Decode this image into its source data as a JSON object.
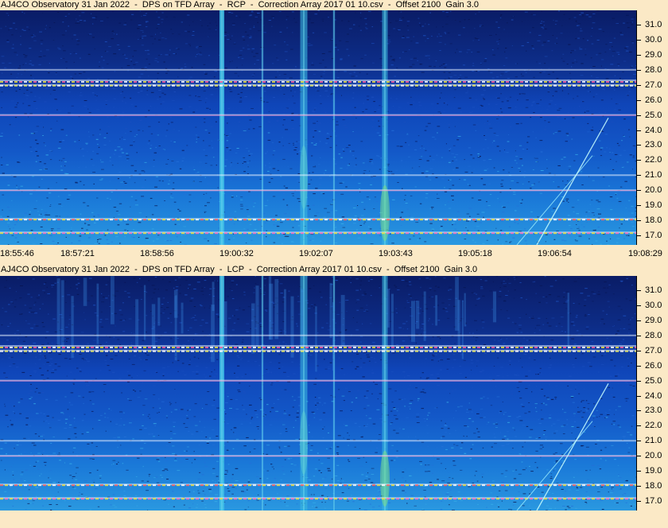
{
  "panels": [
    {
      "title": "AJ4CO Observatory 31 Jan 2022  -  DPS on TFD Array  -  RCP  -  Correction Array 2017 01 10.csv  -  Offset 2100  Gain 3.0",
      "polarization": "RCP"
    },
    {
      "title": "AJ4CO Observatory 31 Jan 2022  -  DPS on TFD Array  -  LCP  -  Correction Array 2017 01 10.csv  -  Offset 2100  Gain 3.0",
      "polarization": "LCP"
    }
  ],
  "chart_data": {
    "type": "heatmap",
    "description_colors": {
      "low": "#0a1a5a",
      "mid": "#1060d0",
      "high": "#40c8e0",
      "hot": "#f0f060",
      "background": "#fbe9c6"
    },
    "y_ticks": [
      "31.0",
      "30.0",
      "29.0",
      "28.0",
      "27.0",
      "26.0",
      "25.0",
      "24.0",
      "23.0",
      "22.0",
      "21.0",
      "20.0",
      "19.0",
      "18.0",
      "17.0"
    ],
    "y_range": [
      16.5,
      31.8
    ],
    "x_ticks": [
      "18:55:46",
      "18:57:21",
      "18:58:56",
      "19:00:32",
      "19:02:07",
      "19:03:43",
      "19:05:18",
      "19:06:54",
      "19:08:29"
    ],
    "interference_lines_mhz": [
      28.0,
      27.3,
      27.0,
      25.0,
      21.0,
      20.0,
      18.1,
      17.2
    ]
  }
}
